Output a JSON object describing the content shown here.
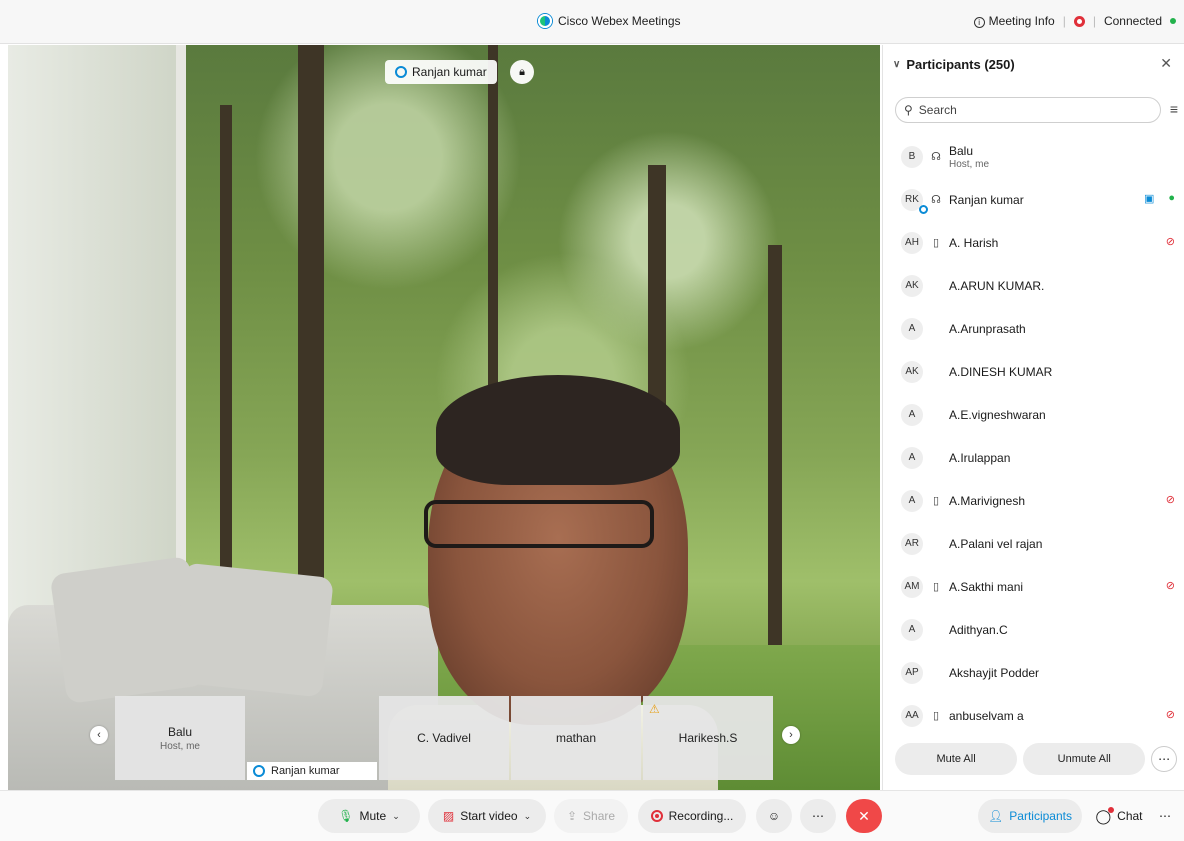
{
  "titlebar": {
    "app_title": "Cisco Webex Meetings",
    "meeting_info": "Meeting Info",
    "status": "Connected"
  },
  "stage": {
    "active_speaker": "Ranjan kumar",
    "filmstrip": [
      {
        "name": "Balu",
        "sub": "Host, me",
        "kind": "placeholder"
      },
      {
        "name": "Ranjan kumar",
        "sub": "",
        "kind": "video"
      },
      {
        "name": "C. Vadivel",
        "sub": "",
        "kind": "placeholder"
      },
      {
        "name": "mathan",
        "sub": "",
        "kind": "placeholder"
      },
      {
        "name": "Harikesh.S",
        "sub": "",
        "kind": "placeholder",
        "warning": true
      }
    ]
  },
  "panel": {
    "title": "Participants (250)",
    "search_placeholder": "Search",
    "participants": [
      {
        "initials": "B",
        "name": "Balu",
        "sub": "Host, me",
        "device": "headset",
        "video": false,
        "mic": "none"
      },
      {
        "initials": "RK",
        "name": "Ranjan kumar",
        "sub": "",
        "device": "headset",
        "video": true,
        "mic": "on",
        "presence": true
      },
      {
        "initials": "AH",
        "name": "A. Harish",
        "sub": "",
        "device": "phone",
        "video": false,
        "mic": "muted"
      },
      {
        "initials": "AK",
        "name": "A.ARUN KUMAR.",
        "sub": "",
        "device": "",
        "video": false,
        "mic": "none"
      },
      {
        "initials": "A",
        "name": "A.Arunprasath",
        "sub": "",
        "device": "",
        "video": false,
        "mic": "none"
      },
      {
        "initials": "AK",
        "name": "A.DINESH KUMAR",
        "sub": "",
        "device": "",
        "video": false,
        "mic": "none"
      },
      {
        "initials": "A",
        "name": "A.E.vigneshwaran",
        "sub": "",
        "device": "",
        "video": false,
        "mic": "none"
      },
      {
        "initials": "A",
        "name": "A.Irulappan",
        "sub": "",
        "device": "",
        "video": false,
        "mic": "none"
      },
      {
        "initials": "A",
        "name": "A.Marivignesh",
        "sub": "",
        "device": "phone",
        "video": false,
        "mic": "muted"
      },
      {
        "initials": "AR",
        "name": "A.Palani vel rajan",
        "sub": "",
        "device": "",
        "video": false,
        "mic": "none"
      },
      {
        "initials": "AM",
        "name": "A.Sakthi mani",
        "sub": "",
        "device": "phone",
        "video": false,
        "mic": "muted"
      },
      {
        "initials": "A",
        "name": "Adithyan.C",
        "sub": "",
        "device": "",
        "video": false,
        "mic": "none"
      },
      {
        "initials": "AP",
        "name": "Akshayjit Podder",
        "sub": "",
        "device": "",
        "video": false,
        "mic": "none"
      },
      {
        "initials": "AA",
        "name": "anbuselvam a",
        "sub": "",
        "device": "phone",
        "video": false,
        "mic": "muted"
      }
    ],
    "mute_all": "Mute All",
    "unmute_all": "Unmute All"
  },
  "toolbar": {
    "mute": "Mute",
    "start_video": "Start video",
    "share": "Share",
    "recording": "Recording...",
    "participants": "Participants",
    "chat": "Chat"
  },
  "colors": {
    "accent": "#0a8bd6",
    "muted": "#e0303a",
    "active": "#22b24c",
    "end_call": "#f04848"
  }
}
